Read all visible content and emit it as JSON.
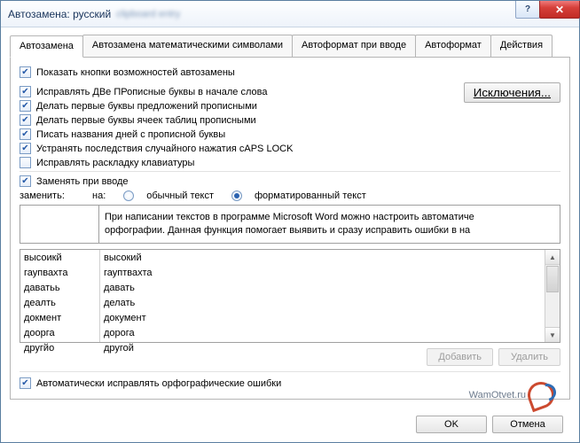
{
  "titlebar": {
    "title": "Автозамена: русский"
  },
  "tabs": {
    "t1": "Автозамена",
    "t2": "Автозамена математическими символами",
    "t3": "Автоформат при вводе",
    "t4": "Автоформат",
    "t5": "Действия"
  },
  "checks": {
    "show_opts": "Показать кнопки возможностей автозамены",
    "two_caps": "Исправлять ДВе ПРописные буквы в начале слова",
    "sentence_caps": "Делать первые буквы предложений прописными",
    "table_caps": "Делать первые буквы ячеек таблиц прописными",
    "day_names": "Писать названия дней с прописной буквы",
    "caps_lock": "Устранять последствия случайного нажатия cAPS LOCK",
    "keyboard_layout": "Исправлять раскладку клавиатуры",
    "replace_on_type": "Заменять при вводе",
    "auto_spell": "Автоматически исправлять орфографические ошибки"
  },
  "exceptions_btn": "Исключения...",
  "replace_label": "заменить:",
  "on_label": "на:",
  "radio_plain": "обычный текст",
  "radio_formatted": "форматированный текст",
  "preview_text": "При написании текстов в программе Microsoft Word можно настроить автоматиче\nорфографии. Данная функция помогает выявить и сразу исправить ошибки в на",
  "table": {
    "left": [
      "высоикй",
      "гаупвахта",
      "даватьь",
      "деалть",
      "докмент",
      "доорга",
      "другйо"
    ],
    "right": [
      "высокий",
      "гауптвахта",
      "давать",
      "делать",
      "документ",
      "дорога",
      "другой"
    ]
  },
  "buttons": {
    "add": "Добавить",
    "delete": "Удалить",
    "ok": "OK",
    "cancel": "Отмена"
  },
  "watermark": "WamOtvet.ru"
}
